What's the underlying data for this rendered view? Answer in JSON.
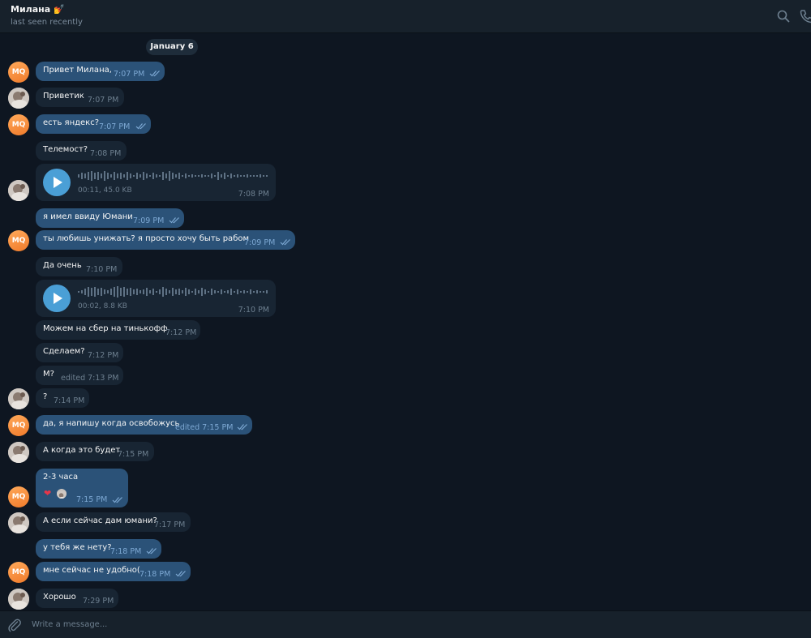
{
  "header": {
    "name": "Милана",
    "name_emoji": "💅",
    "status": "last seen recently"
  },
  "date_label": "January 6",
  "messages": [
    {
      "text": "Привет Милана,",
      "time": "7:07 PM"
    },
    {
      "text": "Приветик",
      "time": "7:07 PM"
    },
    {
      "text": "есть яндекс?",
      "time": "7:07 PM"
    },
    {
      "text": "Телемост?",
      "time": "7:08 PM"
    },
    {
      "text": "я имел ввиду Юмани",
      "time": "7:09 PM"
    },
    {
      "text": "ты любишь унижать? я просто хочу быть рабом",
      "time": "7:09 PM"
    },
    {
      "text": "Да очень",
      "time": "7:10 PM"
    },
    {
      "text": "Можем на сбер на тинькофф",
      "time": "7:12 PM"
    },
    {
      "text": "Сделаем?",
      "time": "7:12 PM"
    },
    {
      "text": "М?",
      "time": "edited 7:13 PM"
    },
    {
      "text": "?",
      "time": "7:14 PM"
    },
    {
      "text": "да, я напишу когда освобожусь",
      "time": "edited 7:15 PM"
    },
    {
      "text": "А когда это будет",
      "time": "7:15 PM"
    },
    {
      "text": "2-3 часа",
      "time": "7:15 PM",
      "reaction": "❤"
    },
    {
      "text": "А если сейчас дам юмани?",
      "time": "7:17 PM"
    },
    {
      "text": "у тебя же нету?",
      "time": "7:18 PM"
    },
    {
      "text": "мне сейчас не удобно(",
      "time": "7:18 PM"
    },
    {
      "text": "Хорошо",
      "time": "7:29 PM"
    }
  ],
  "voice": [
    {
      "meta": "00:11, 45.0 KB",
      "time": "7:08 PM"
    },
    {
      "meta": "00:02, 8.8 KB",
      "time": "7:10 PM"
    }
  ],
  "avatar_initials": "MQ",
  "composer": {
    "placeholder": "Write a message..."
  },
  "icons": {
    "search": "search-icon",
    "call": "phone-icon",
    "attach": "paperclip-icon",
    "play": "play-icon",
    "read": "double-check-icon"
  },
  "colors": {
    "background": "#0e1621",
    "panel": "#17212b",
    "bubble_in": "#182533",
    "bubble_out": "#2b5278",
    "accent": "#4a9fd6",
    "avatar": "#f58a3c"
  }
}
